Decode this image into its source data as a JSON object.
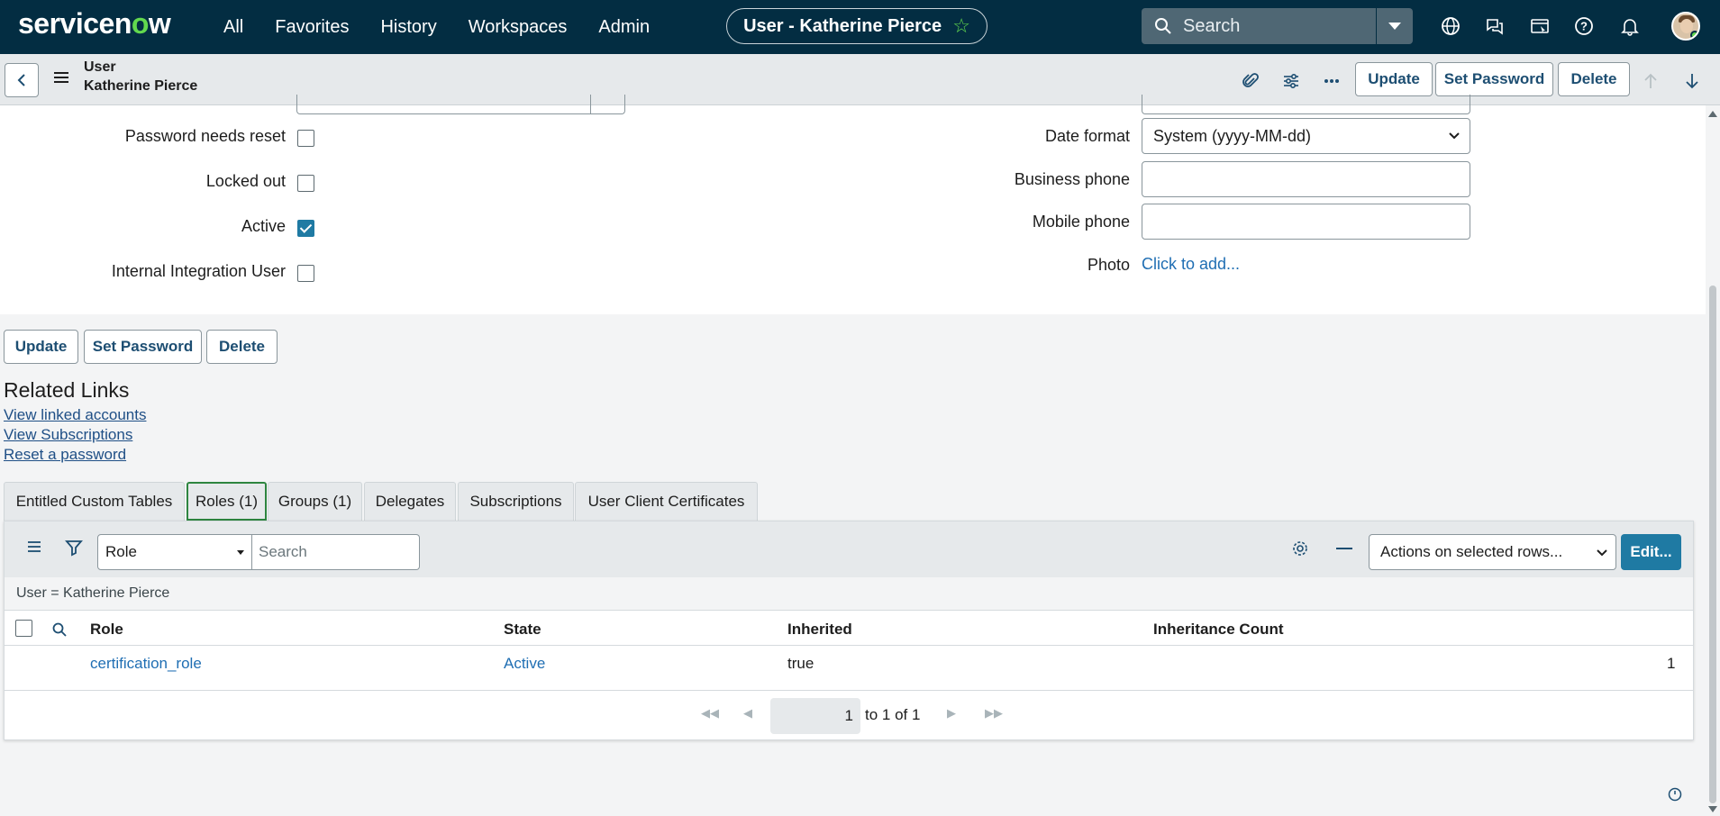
{
  "nav": {
    "logo_pre": "servicen",
    "logo_o": "o",
    "logo_post": "w",
    "menu": [
      "All",
      "Favorites",
      "History",
      "Workspaces",
      "Admin"
    ],
    "page_title": "User - Katherine Pierce",
    "search_placeholder": "Search",
    "icons": [
      "globe-icon",
      "chat-icon",
      "screen-icon",
      "help-icon",
      "bell-icon"
    ]
  },
  "header": {
    "record_type": "User",
    "record_name": "Katherine Pierce",
    "update_label": "Update",
    "set_password_label": "Set Password",
    "delete_label": "Delete"
  },
  "form": {
    "left": {
      "password_needs_reset": {
        "label": "Password needs reset",
        "checked": false
      },
      "locked_out": {
        "label": "Locked out",
        "checked": false
      },
      "active": {
        "label": "Active",
        "checked": true
      },
      "internal_integration_user": {
        "label": "Internal Integration User",
        "checked": false
      }
    },
    "right": {
      "date_format": {
        "label": "Date format",
        "value": "System (yyyy-MM-dd)"
      },
      "business_phone": {
        "label": "Business phone",
        "value": ""
      },
      "mobile_phone": {
        "label": "Mobile phone",
        "value": ""
      },
      "photo": {
        "label": "Photo",
        "link": "Click to add..."
      }
    }
  },
  "bottom_buttons": {
    "update": "Update",
    "set_password": "Set Password",
    "delete": "Delete"
  },
  "related_links": {
    "title": "Related Links",
    "links": [
      "View linked accounts",
      "View Subscriptions",
      "Reset a password"
    ]
  },
  "tabs": [
    {
      "label": "Entitled Custom Tables",
      "active": false
    },
    {
      "label": "Roles (1)",
      "active": true
    },
    {
      "label": "Groups (1)",
      "active": false
    },
    {
      "label": "Delegates",
      "active": false
    },
    {
      "label": "Subscriptions",
      "active": false
    },
    {
      "label": "User Client Certificates",
      "active": false
    }
  ],
  "list": {
    "filter_field": "Role",
    "search_placeholder": "Search",
    "actions_select": "Actions on selected rows...",
    "edit_label": "Edit...",
    "breadcrumb": "User = Katherine Pierce",
    "columns": [
      "Role",
      "State",
      "Inherited",
      "Inheritance Count"
    ],
    "rows": [
      {
        "role": "certification_role",
        "state": "Active",
        "inherited": "true",
        "inheritance_count": "1"
      }
    ],
    "pager": {
      "page": "1",
      "text": "to 1 of 1"
    }
  }
}
